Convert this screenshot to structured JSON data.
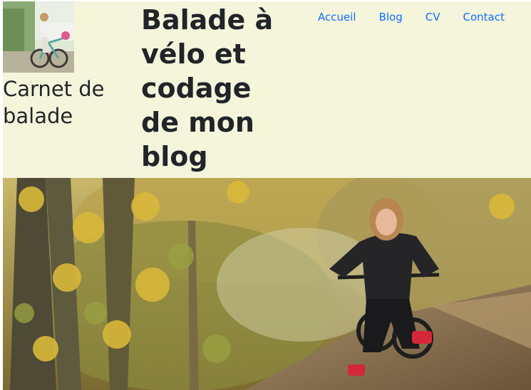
{
  "header": {
    "brand_name": "Carnet de balade",
    "site_title": "Balade à vélo et codage de mon blog",
    "logo_alt": "logo",
    "nav": [
      {
        "label": "Accueil"
      },
      {
        "label": "Blog"
      },
      {
        "label": "CV"
      },
      {
        "label": "Contact"
      }
    ]
  },
  "hero": {
    "image_alt": "hero"
  },
  "colors": {
    "header_bg": "#f5f5dc",
    "link": "#0d6efd",
    "text": "#212529"
  }
}
